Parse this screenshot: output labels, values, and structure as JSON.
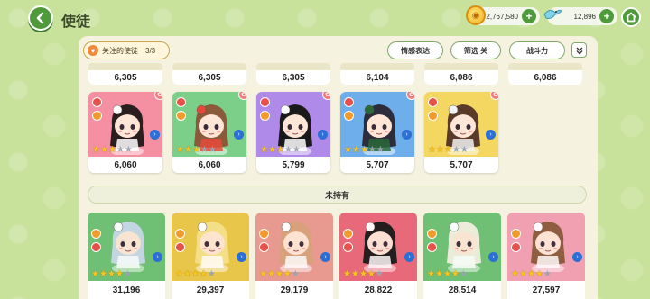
{
  "header": {
    "title": "使徒",
    "back_icon": "back-arrow-icon",
    "currency_gold": "2,767,580",
    "currency_bird": "12,896",
    "plus": "+",
    "home_icon": "home-icon"
  },
  "filters": {
    "focus_label": "关注的使徒",
    "focus_count": "3/3",
    "emotion": "情感表达",
    "filter": "筛选 关",
    "power": "战斗力",
    "expand_icon": "double-chevron-down-icon"
  },
  "peek_powers": [
    "6,305",
    "6,305",
    "6,305",
    "6,104",
    "6,086",
    "6,086"
  ],
  "owned": [
    {
      "power": "6,060",
      "bg": "#f58fa2",
      "hair": "#2a1e1e",
      "acc": "#ffffff",
      "stars": 3
    },
    {
      "power": "6,060",
      "bg": "#7ccf88",
      "hair": "#8a5a3a",
      "acc": "#e64a3a",
      "stars": 3
    },
    {
      "power": "5,799",
      "bg": "#b08ae8",
      "hair": "#1a1a1a",
      "acc": "#ffffff",
      "stars": 3
    },
    {
      "power": "5,707",
      "bg": "#6eaeea",
      "hair": "#2c2c3a",
      "acc": "#2a6a3a",
      "stars": 3
    },
    {
      "power": "5,707",
      "bg": "#f3d760",
      "hair": "#5a3a28",
      "acc": "#f2f2f2",
      "stars": 3
    }
  ],
  "unowned_label": "未持有",
  "unowned": [
    {
      "power": "31,196",
      "bg": "#6fbf74",
      "hair": "#c9d7e8"
    },
    {
      "power": "29,397",
      "bg": "#e8c64a",
      "hair": "#f5e08a"
    },
    {
      "power": "29,179",
      "bg": "#e89a90",
      "hair": "#d8a27a"
    },
    {
      "power": "28,822",
      "bg": "#e86a7a",
      "hair": "#1a1a1a"
    },
    {
      "power": "28,514",
      "bg": "#6fbf74",
      "hair": "#f2efe0"
    },
    {
      "power": "27,597",
      "bg": "#f0a0b0",
      "hair": "#8a5a3a"
    }
  ],
  "colors": {
    "accent_green": "#4f9a3a",
    "panel": "#f5f2e0",
    "star": "#f6c522"
  }
}
